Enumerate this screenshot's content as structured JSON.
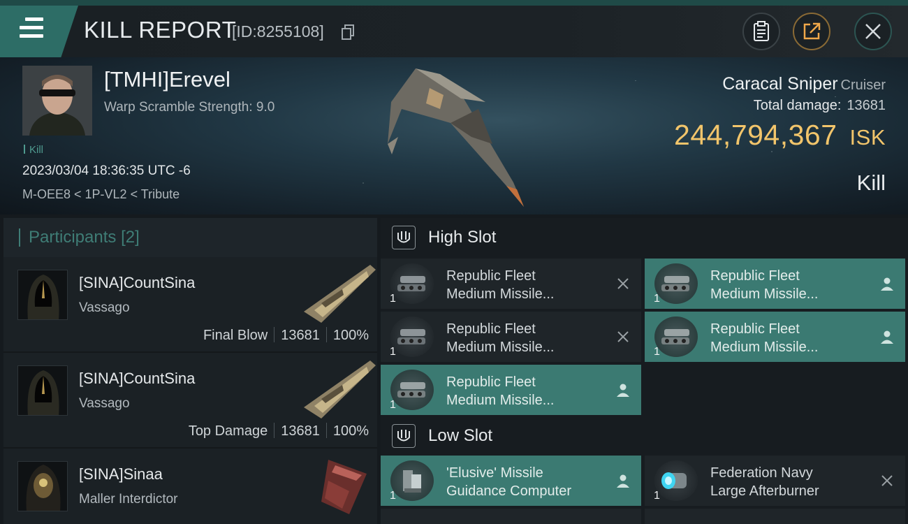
{
  "header": {
    "title": "KILL REPORT",
    "report_id": "[ID:8255108]"
  },
  "victim": {
    "name": "[TMHI]Erevel",
    "subtitle": "Warp Scramble Strength: 9.0",
    "tag": "Kill",
    "datetime": "2023/03/04 18:36:35 UTC -6",
    "location": "M-OEE8 < 1P-VL2 < Tribute",
    "ship_name": "Caracal Sniper",
    "ship_class": "Cruiser",
    "damage_label": "Total damage:",
    "damage_value": "13681",
    "isk_value": "244,794,367",
    "isk_unit": "ISK",
    "result": "Kill"
  },
  "participants": {
    "label": "Participants",
    "count": "[2]",
    "rows": [
      {
        "name": "[SINA]CountSina",
        "ship": "Vassago",
        "role": "Final Blow",
        "damage": "13681",
        "percent": "100%"
      },
      {
        "name": "[SINA]CountSina",
        "ship": "Vassago",
        "role": "Top Damage",
        "damage": "13681",
        "percent": "100%"
      },
      {
        "name": "[SINA]Sinaa",
        "ship": "Maller Interdictor",
        "badge": "i"
      }
    ]
  },
  "fitting": {
    "high_slot_label": "High Slot",
    "low_slot_label": "Low Slot",
    "high": [
      {
        "name": "Republic Fleet\nMedium Missile...",
        "qty": "1",
        "status": "destroyed"
      },
      {
        "name": "Republic Fleet\nMedium Missile...",
        "qty": "1",
        "status": "dropped"
      },
      {
        "name": "Republic Fleet\nMedium Missile...",
        "qty": "1",
        "status": "destroyed"
      },
      {
        "name": "Republic Fleet\nMedium Missile...",
        "qty": "1",
        "status": "dropped"
      },
      {
        "name": "Republic Fleet\nMedium Missile...",
        "qty": "1",
        "status": "dropped"
      }
    ],
    "low": [
      {
        "name": "'Elusive' Missile\nGuidance Computer",
        "qty": "1",
        "status": "dropped"
      },
      {
        "name": "Federation Navy\nLarge Afterburner",
        "qty": "1",
        "status": "destroyed"
      }
    ]
  },
  "colors": {
    "accent": "#3b7a72",
    "isk": "#f2c56b",
    "background": "#151a1e"
  }
}
